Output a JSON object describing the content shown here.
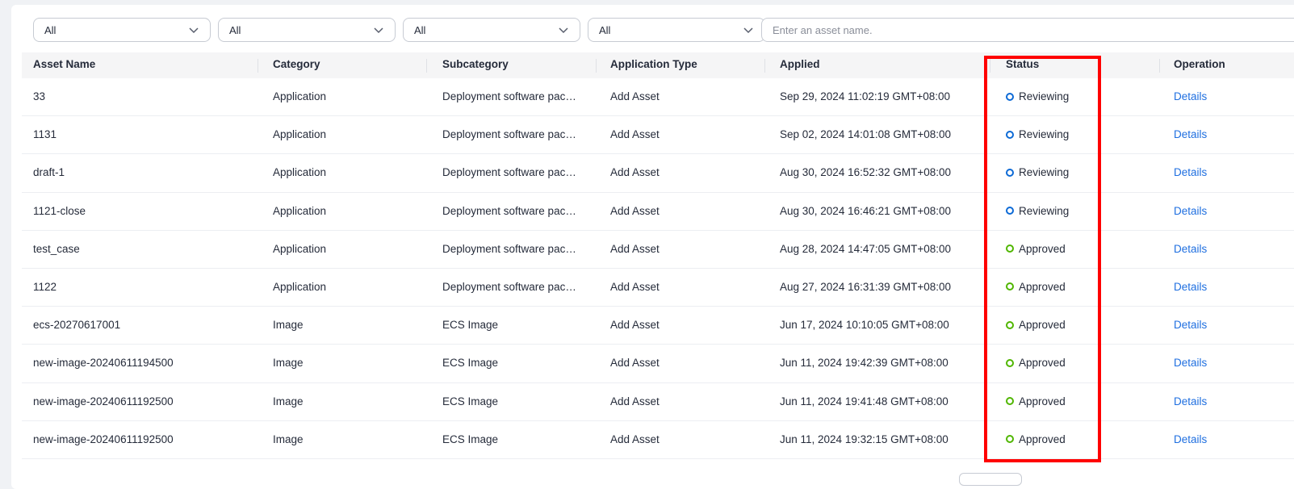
{
  "filters": {
    "selects": [
      "All",
      "All",
      "All",
      "All"
    ],
    "search_placeholder": "Enter an asset name."
  },
  "table": {
    "columns": {
      "asset_name": "Asset Name",
      "category": "Category",
      "subcategory": "Subcategory",
      "application_type": "Application Type",
      "applied": "Applied",
      "status": "Status",
      "operation": "Operation"
    },
    "rows": [
      {
        "asset_name": "33",
        "category": "Application",
        "subcategory": "Deployment software package",
        "application_type": "Add Asset",
        "applied": "Sep 29, 2024 11:02:19 GMT+08:00",
        "status": "Reviewing",
        "operation": "Details"
      },
      {
        "asset_name": "1131",
        "category": "Application",
        "subcategory": "Deployment software package",
        "application_type": "Add Asset",
        "applied": "Sep 02, 2024 14:01:08 GMT+08:00",
        "status": "Reviewing",
        "operation": "Details"
      },
      {
        "asset_name": "draft-1",
        "category": "Application",
        "subcategory": "Deployment software package",
        "application_type": "Add Asset",
        "applied": "Aug 30, 2024 16:52:32 GMT+08:00",
        "status": "Reviewing",
        "operation": "Details"
      },
      {
        "asset_name": "1121-close",
        "category": "Application",
        "subcategory": "Deployment software package",
        "application_type": "Add Asset",
        "applied": "Aug 30, 2024 16:46:21 GMT+08:00",
        "status": "Reviewing",
        "operation": "Details"
      },
      {
        "asset_name": "test_case",
        "category": "Application",
        "subcategory": "Deployment software package",
        "application_type": "Add Asset",
        "applied": "Aug 28, 2024 14:47:05 GMT+08:00",
        "status": "Approved",
        "operation": "Details"
      },
      {
        "asset_name": "1122",
        "category": "Application",
        "subcategory": "Deployment software package",
        "application_type": "Add Asset",
        "applied": "Aug 27, 2024 16:31:39 GMT+08:00",
        "status": "Approved",
        "operation": "Details"
      },
      {
        "asset_name": "ecs-20270617001",
        "category": "Image",
        "subcategory": "ECS Image",
        "application_type": "Add Asset",
        "applied": "Jun 17, 2024 10:10:05 GMT+08:00",
        "status": "Approved",
        "operation": "Details"
      },
      {
        "asset_name": "new-image-20240611194500",
        "category": "Image",
        "subcategory": "ECS Image",
        "application_type": "Add Asset",
        "applied": "Jun 11, 2024 19:42:39 GMT+08:00",
        "status": "Approved",
        "operation": "Details"
      },
      {
        "asset_name": "new-image-20240611192500",
        "category": "Image",
        "subcategory": "ECS Image",
        "application_type": "Add Asset",
        "applied": "Jun 11, 2024 19:41:48 GMT+08:00",
        "status": "Approved",
        "operation": "Details"
      },
      {
        "asset_name": "new-image-20240611192500",
        "category": "Image",
        "subcategory": "ECS Image",
        "application_type": "Add Asset",
        "applied": "Jun 11, 2024 19:32:15 GMT+08:00",
        "status": "Approved",
        "operation": "Details"
      }
    ]
  },
  "colors": {
    "reviewing": "#0d6ad6",
    "approved": "#50b600",
    "link": "#1f6fe0",
    "highlight": "#ff0000"
  },
  "icons": {
    "select_chevron": "chevron-down-icon",
    "status_reviewing": "circle-outline-blue-icon",
    "status_approved": "circle-outline-green-icon"
  }
}
